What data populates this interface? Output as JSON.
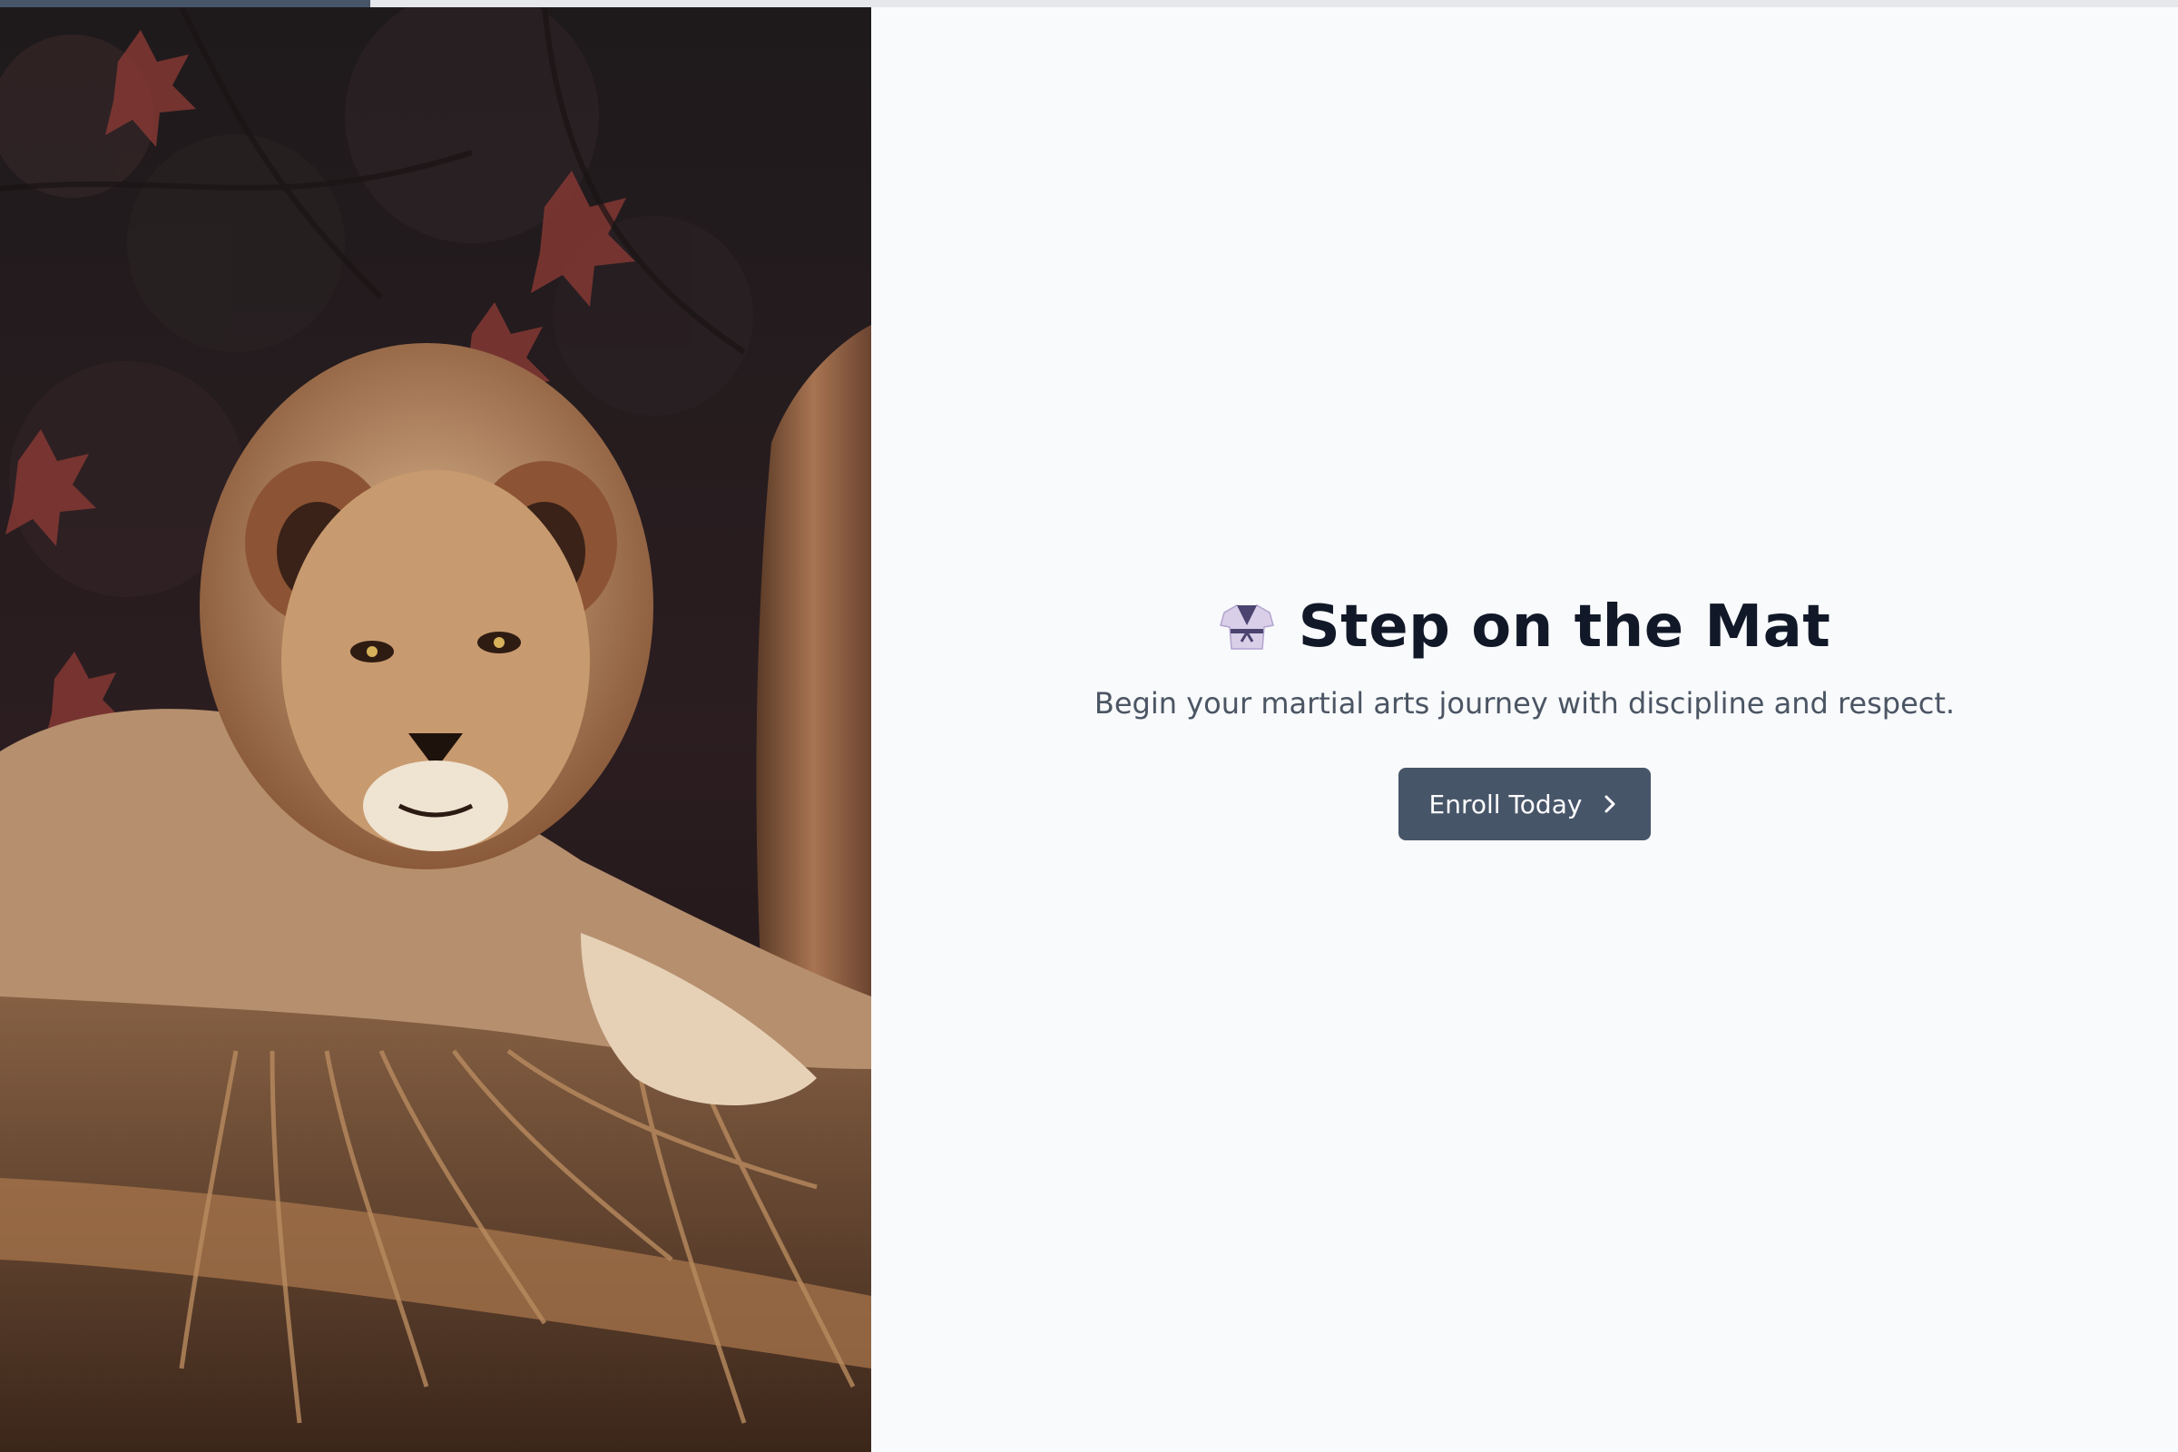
{
  "progress": {
    "value": 0.17
  },
  "hero": {
    "icon": "martial-arts-uniform-icon",
    "title": "Step on the Mat",
    "subtitle": "Begin your martial arts journey with discipline and respect.",
    "cta_label": "Enroll Today",
    "cta_icon": "chevron-right-icon"
  },
  "image": {
    "subject": "lion-photo"
  },
  "colors": {
    "background": "#f8fafc",
    "title": "#111827",
    "subtitle": "#4b5563",
    "button": "#475569",
    "progress_track": "#e5e7eb",
    "progress_fill": "#475569"
  }
}
